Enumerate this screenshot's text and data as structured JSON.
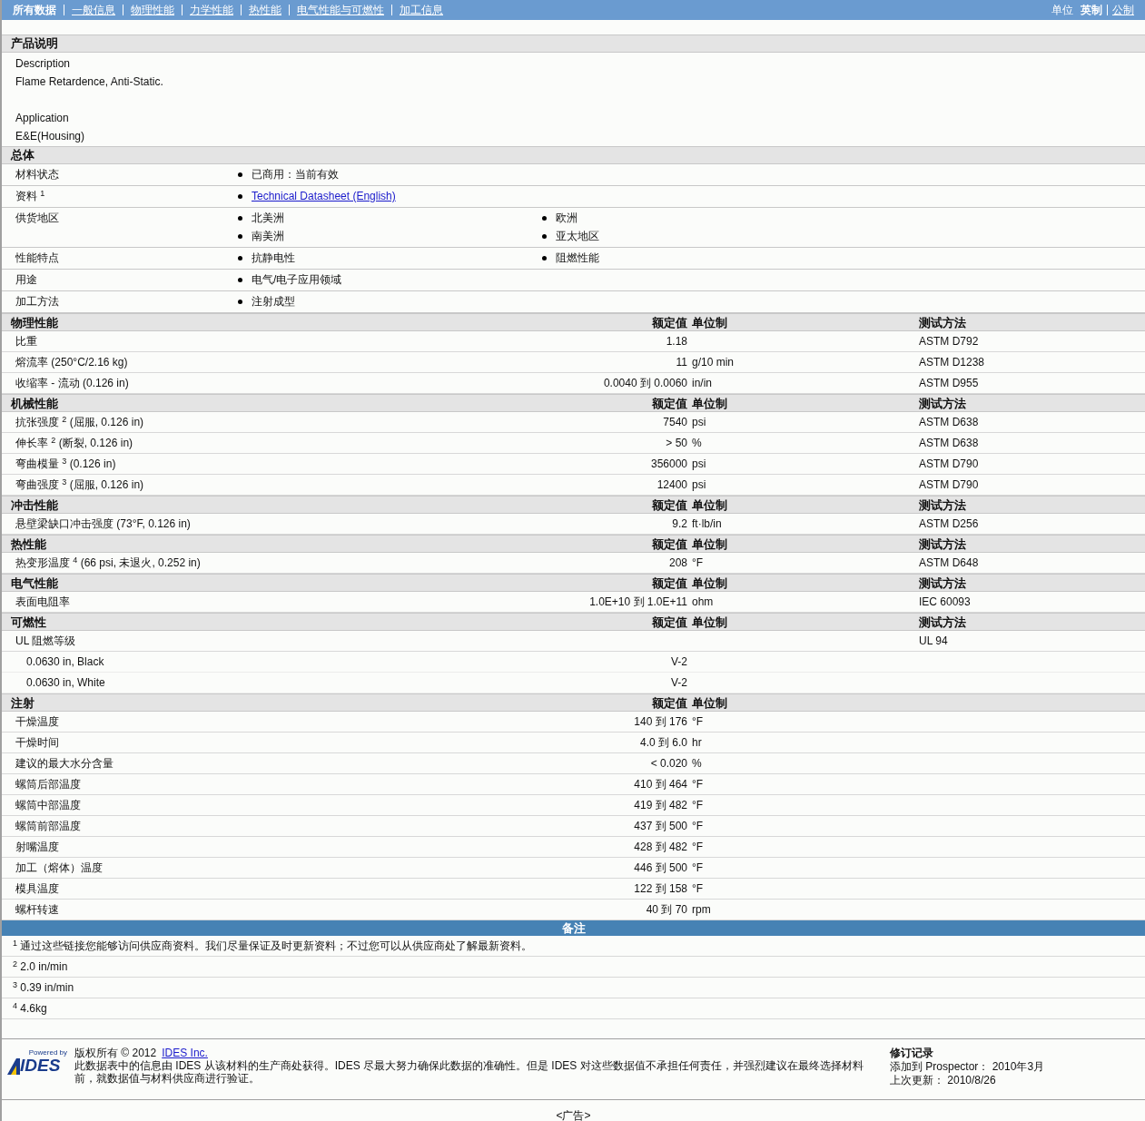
{
  "nav": {
    "items": [
      {
        "label": "所有数据",
        "selected": true
      },
      {
        "label": "一般信息",
        "selected": false
      },
      {
        "label": "物理性能",
        "selected": false
      },
      {
        "label": "力学性能",
        "selected": false
      },
      {
        "label": "热性能",
        "selected": false
      },
      {
        "label": "电气性能与可燃性",
        "selected": false
      },
      {
        "label": "加工信息",
        "selected": false
      }
    ],
    "unit_label": "单位",
    "units": [
      {
        "label": "英制",
        "selected": true
      },
      {
        "label": "公制",
        "selected": false
      }
    ]
  },
  "description": {
    "title": "产品说明",
    "paragraphs": [
      {
        "lines": [
          "Description",
          "Flame Retardence, Anti-Static."
        ]
      },
      {
        "lines": [
          "Application",
          "E&E(Housing)"
        ]
      }
    ]
  },
  "general": {
    "title": "总体",
    "rows": [
      {
        "label": "材料状态",
        "items": [
          {
            "kind": "text",
            "text": "已商用：当前有效"
          }
        ]
      },
      {
        "label": "资料 $^{1}$",
        "items": [
          {
            "kind": "link",
            "text": "Technical Datasheet (English)"
          }
        ]
      },
      {
        "label": "供货地区",
        "items": [
          {
            "kind": "text",
            "text": "北美洲"
          },
          {
            "kind": "text",
            "text": "欧洲"
          },
          {
            "kind": "text",
            "text": "南美洲"
          },
          {
            "kind": "text",
            "text": "亚太地区"
          }
        ]
      },
      {
        "label": "性能特点",
        "items": [
          {
            "kind": "text",
            "text": "抗静电性"
          },
          {
            "kind": "text",
            "text": "阻燃性能"
          }
        ]
      },
      {
        "label": "用途",
        "items": [
          {
            "kind": "text",
            "text": "电气/电子应用领域"
          }
        ]
      },
      {
        "label": "加工方法",
        "items": [
          {
            "kind": "text",
            "text": "注射成型"
          }
        ]
      }
    ]
  },
  "property_sections": [
    {
      "title": "物理性能",
      "headers": [
        "额定值",
        "单位制",
        "测试方法"
      ],
      "rows": [
        {
          "label": "比重",
          "value": "1.18",
          "method": "ASTM D792"
        },
        {
          "label": "熔流率 (250°C/2.16 kg)",
          "value": "11",
          "unit": "g/10 min",
          "method": "ASTM D1238"
        },
        {
          "label": "收缩率 - 流动 (0.126 in)",
          "value": "0.0040 到 0.0060",
          "unit": "in/in",
          "method": "ASTM D955"
        }
      ]
    },
    {
      "title": "机械性能",
      "headers": [
        "额定值",
        "单位制",
        "测试方法"
      ],
      "rows": [
        {
          "label": "抗张强度 $^{2}$ (屈服, 0.126 in)",
          "value": "7540",
          "unit": "psi",
          "method": "ASTM D638"
        },
        {
          "label": "伸长率 $^{2}$ (断裂, 0.126 in)",
          "value": "> 50",
          "unit": "%",
          "method": "ASTM D638"
        },
        {
          "label": "弯曲模量 $^{3}$ (0.126 in)",
          "value": "356000",
          "unit": "psi",
          "method": "ASTM D790"
        },
        {
          "label": "弯曲强度 $^{3}$ (屈服, 0.126 in)",
          "value": "12400",
          "unit": "psi",
          "method": "ASTM D790"
        }
      ]
    },
    {
      "title": "冲击性能",
      "headers": [
        "额定值",
        "单位制",
        "测试方法"
      ],
      "rows": [
        {
          "label": "悬壁梁缺口冲击强度 (73°F, 0.126 in)",
          "value": "9.2",
          "unit": "ft·lb/in",
          "method": "ASTM D256"
        }
      ]
    },
    {
      "title": "热性能",
      "headers": [
        "额定值",
        "单位制",
        "测试方法"
      ],
      "rows": [
        {
          "label": "热变形温度 $^{4}$ (66 psi, 未退火, 0.252 in)",
          "value": "208",
          "unit": "°F",
          "method": "ASTM D648"
        }
      ]
    },
    {
      "title": "电气性能",
      "headers": [
        "额定值",
        "单位制",
        "测试方法"
      ],
      "rows": [
        {
          "label": "表面电阻率",
          "value": "1.0E+10 到 1.0E+11",
          "unit": "ohm",
          "method": "IEC 60093"
        }
      ]
    },
    {
      "title": "可燃性",
      "headers": [
        "额定值",
        "单位制",
        "测试方法"
      ],
      "rows": [
        {
          "label": "UL 阻燃等级",
          "method": "UL 94",
          "children": [
            {
              "label": "0.0630 in, Black",
              "value": "V-2"
            },
            {
              "label": "0.0630 in, White",
              "value": "V-2"
            }
          ]
        }
      ]
    },
    {
      "title": "注射",
      "headers": [
        "额定值",
        "单位制"
      ],
      "rows": [
        {
          "label": "干燥温度",
          "value": "140 到 176",
          "unit": "°F"
        },
        {
          "label": "干燥时间",
          "value": "4.0 到 6.0",
          "unit": "hr"
        },
        {
          "label": "建议的最大水分含量",
          "value": "< 0.020",
          "unit": "%"
        },
        {
          "label": "螺筒后部温度",
          "value": "410 到 464",
          "unit": "°F"
        },
        {
          "label": "螺筒中部温度",
          "value": "419 到 482",
          "unit": "°F"
        },
        {
          "label": "螺筒前部温度",
          "value": "437 到 500",
          "unit": "°F"
        },
        {
          "label": "射嘴温度",
          "value": "428 到 482",
          "unit": "°F"
        },
        {
          "label": "加工（熔体）温度",
          "value": "446 到 500",
          "unit": "°F"
        },
        {
          "label": "模具温度",
          "value": "122 到 158",
          "unit": "°F"
        },
        {
          "label": "螺杆转速",
          "value": "40 到 70",
          "unit": "rpm"
        }
      ]
    }
  ],
  "notes": {
    "title": "备注",
    "items": [
      "$^{1}$ 通过这些链接您能够访问供应商资料。我们尽量保证及时更新资料；不过您可以从供应商处了解最新资料。",
      "$^{2}$ 2.0 in/min",
      "$^{3}$ 0.39 in/min",
      "$^{4}$ 4.6kg"
    ]
  },
  "footer": {
    "logo": {
      "tagline": "Powered by",
      "name": "IDES"
    },
    "copyright": "版权所有 © 2012",
    "copyright_link": "IDES Inc.",
    "disclaimer": "此数据表中的信息由 IDES 从该材料的生产商处获得。IDES 尽最大努力确保此数据的准确性。但是 IDES 对这些数据值不承担任何责任，并强烈建议在最终选择材料前，就数据值与材料供应商进行验证。",
    "revision": {
      "title": "修订记录",
      "lines": [
        "添加到 Prospector： 2010年3月",
        "上次更新： 2010/8/26"
      ]
    }
  },
  "ad": "<广告>"
}
